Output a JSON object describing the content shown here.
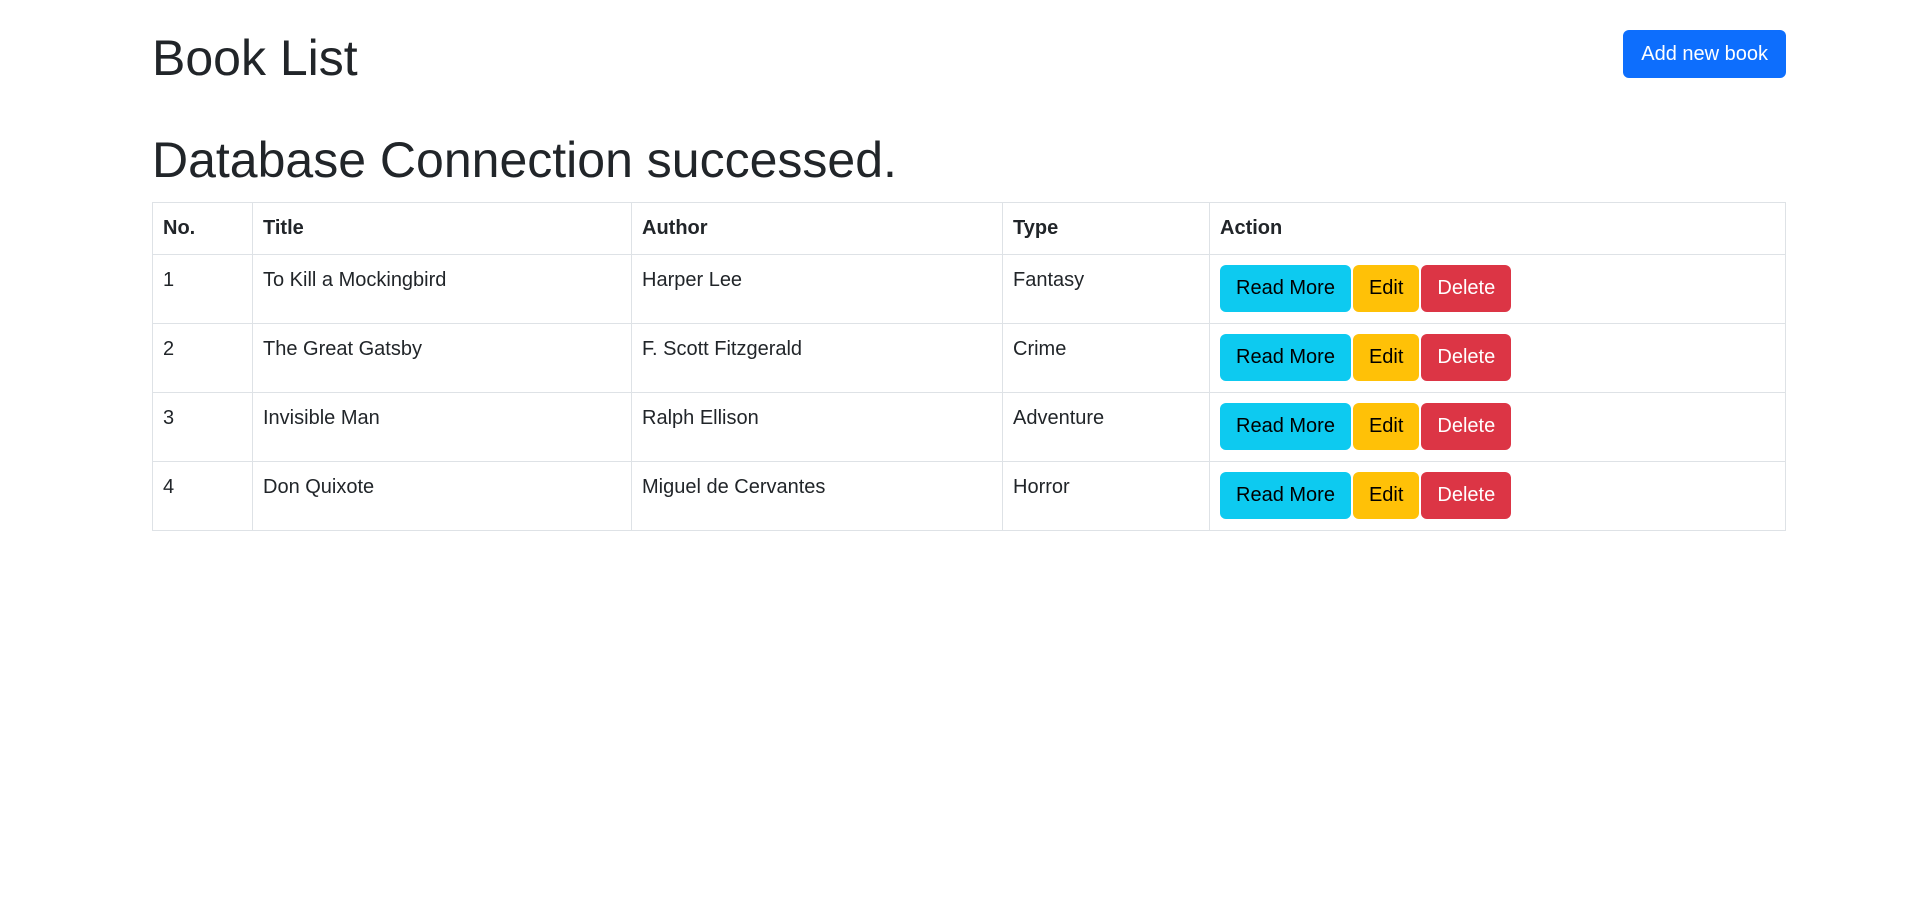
{
  "header": {
    "title": "Book List",
    "add_button_label": "Add new book"
  },
  "status_message": "Database Connection successed.",
  "colors": {
    "primary": "#0d6efd",
    "info": "#0dcaf0",
    "warning": "#ffc107",
    "danger": "#dc3545",
    "border": "#dee2e6",
    "text": "#212529"
  },
  "table": {
    "columns": [
      "No.",
      "Title",
      "Author",
      "Type",
      "Action"
    ],
    "rows": [
      {
        "no": "1",
        "title": "To Kill a Mockingbird",
        "author": "Harper Lee",
        "type": "Fantasy"
      },
      {
        "no": "2",
        "title": "The Great Gatsby",
        "author": "F. Scott Fitzgerald",
        "type": "Crime"
      },
      {
        "no": "3",
        "title": "Invisible Man",
        "author": "Ralph Ellison",
        "type": "Adventure"
      },
      {
        "no": "4",
        "title": "Don Quixote",
        "author": "Miguel de Cervantes",
        "type": "Horror"
      }
    ],
    "actions": {
      "read_more": "Read More",
      "edit": "Edit",
      "delete": "Delete"
    }
  }
}
